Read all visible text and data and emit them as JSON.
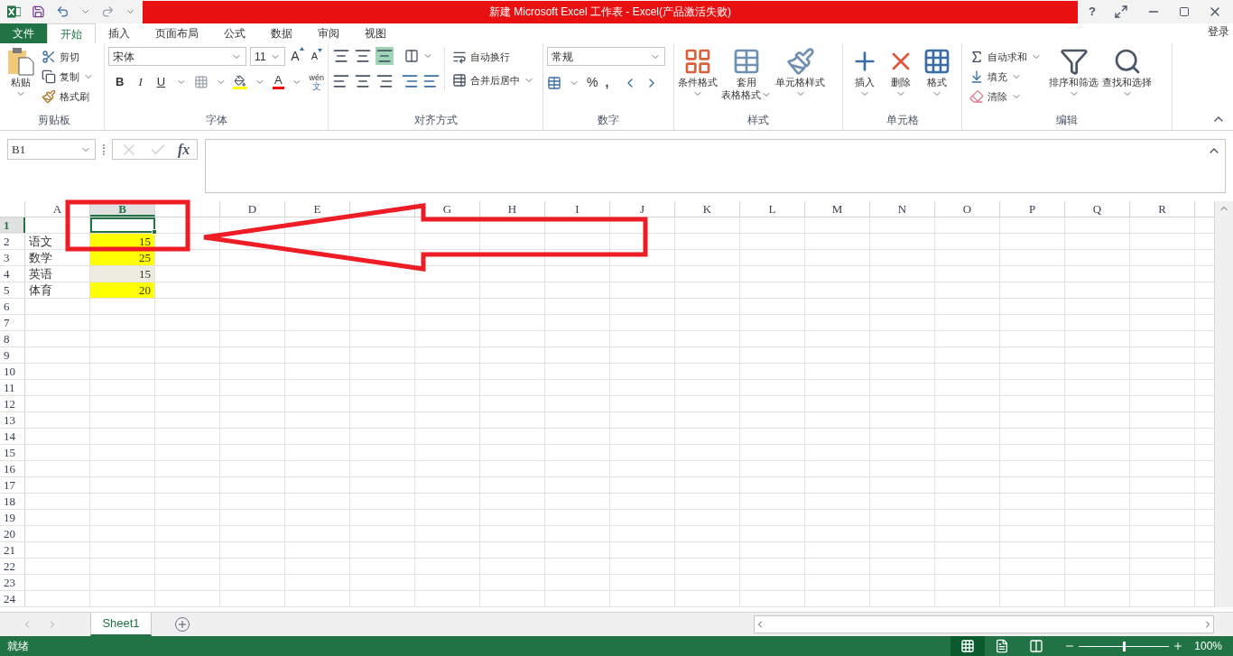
{
  "window": {
    "title": "新建 Microsoft Excel 工作表 -  Excel(产品激活失败)",
    "help": "?"
  },
  "tabs": [
    {
      "label": "文件",
      "kind": "file",
      "selected": false
    },
    {
      "label": "开始",
      "kind": "tab",
      "selected": true
    },
    {
      "label": "插入",
      "kind": "tab",
      "selected": false
    },
    {
      "label": "页面布局",
      "kind": "tab",
      "selected": false
    },
    {
      "label": "公式",
      "kind": "tab",
      "selected": false
    },
    {
      "label": "数据",
      "kind": "tab",
      "selected": false
    },
    {
      "label": "审阅",
      "kind": "tab",
      "selected": false
    },
    {
      "label": "视图",
      "kind": "tab",
      "selected": false
    }
  ],
  "sign_in": "登录",
  "ribbon": {
    "clipboard": {
      "label": "剪贴板",
      "paste": "粘贴",
      "cut": "剪切",
      "copy": "复制",
      "painter": "格式刷"
    },
    "font": {
      "label": "字体",
      "name": "宋体",
      "size": "11",
      "grow": "A",
      "shrink": "A",
      "bold": "B",
      "italic": "I",
      "underline": "U",
      "font_color": "A",
      "phonetic_top": "wén",
      "phonetic_bottom": "文"
    },
    "alignment": {
      "label": "对齐方式",
      "wrap": "自动换行",
      "merge": "合并后居中",
      "bottom_align_selected": true
    },
    "number": {
      "label": "数字",
      "format": "常规",
      "percent": "%",
      "comma": ","
    },
    "styles": {
      "label": "样式",
      "conditional": "条件格式",
      "table_1": "套用",
      "table_2": "表格格式",
      "cell": "单元格样式"
    },
    "cells": {
      "label": "单元格",
      "insert": "插入",
      "delete": "删除",
      "format": "格式"
    },
    "editing": {
      "label": "编辑",
      "autosum": "自动求和",
      "fill": "填充",
      "clear": "清除",
      "sort": "排序和筛选",
      "find": "查找和选择"
    }
  },
  "formula_bar": {
    "name_box": "B1",
    "function": "fx"
  },
  "columns": [
    {
      "label": "A",
      "selected": false
    },
    {
      "label": "B",
      "selected": true
    },
    {
      "selected": false
    },
    {
      "label": "D",
      "selected": false
    },
    {
      "label": "E",
      "selected": false
    },
    {
      "selected": false
    },
    {
      "label": "G",
      "selected": false
    },
    {
      "label": "H",
      "selected": false
    },
    {
      "label": "I",
      "selected": false
    },
    {
      "label": "J",
      "selected": false
    },
    {
      "label": "K",
      "selected": false
    },
    {
      "label": "L",
      "selected": false
    },
    {
      "label": "M",
      "selected": false
    },
    {
      "label": "N",
      "selected": false
    },
    {
      "label": "O",
      "selected": false
    },
    {
      "label": "P",
      "selected": false
    },
    {
      "label": "Q",
      "selected": false
    },
    {
      "label": "R",
      "selected": false
    }
  ],
  "rows": [
    {
      "label": "1",
      "selected": true
    },
    {
      "label": "2",
      "selected": false,
      "a": "语文",
      "b": "15",
      "color": "#ffff00"
    },
    {
      "label": "3",
      "selected": false,
      "a": "数学",
      "b": "25",
      "color": "#ffff00"
    },
    {
      "label": "4",
      "selected": false,
      "a": "英语",
      "b": "15",
      "color": "#eeece1"
    },
    {
      "label": "5",
      "selected": false,
      "a": "体育",
      "b": "20",
      "color": "#ffff00"
    },
    {
      "label": "6",
      "selected": false
    },
    {
      "label": "7",
      "selected": false
    },
    {
      "label": "8",
      "selected": false
    },
    {
      "label": "9",
      "selected": false
    },
    {
      "label": "10",
      "selected": false
    },
    {
      "label": "11",
      "selected": false
    },
    {
      "label": "12",
      "selected": false
    },
    {
      "label": "13",
      "selected": false
    },
    {
      "label": "14",
      "selected": false
    },
    {
      "label": "15",
      "selected": false
    },
    {
      "label": "16",
      "selected": false
    },
    {
      "label": "17",
      "selected": false
    },
    {
      "label": "18",
      "selected": false
    },
    {
      "label": "19",
      "selected": false
    },
    {
      "label": "20",
      "selected": false
    },
    {
      "label": "21",
      "selected": false
    },
    {
      "label": "22",
      "selected": false
    },
    {
      "label": "23",
      "selected": false
    },
    {
      "label": "24",
      "selected": false
    }
  ],
  "sheet_tabs": [
    {
      "label": "Sheet1",
      "selected": true
    }
  ],
  "status_bar": {
    "status": "就绪",
    "views": [
      {
        "kind": "normal",
        "selected": true
      },
      {
        "kind": "page_layout",
        "selected": false
      },
      {
        "kind": "page_break",
        "selected": false
      }
    ],
    "zoom": {
      "level": 0.5,
      "reading": "100%"
    }
  }
}
